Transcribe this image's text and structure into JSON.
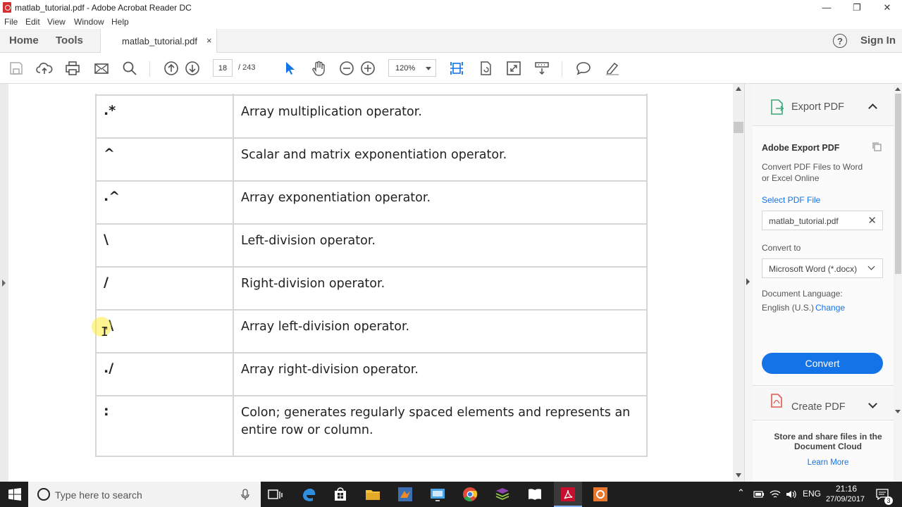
{
  "window": {
    "title": "matlab_tutorial.pdf - Adobe Acrobat Reader DC",
    "minimize": "—",
    "maximize": "❐",
    "close": "✕"
  },
  "menu": [
    "File",
    "Edit",
    "View",
    "Window",
    "Help"
  ],
  "tabs": {
    "home": "Home",
    "tools": "Tools",
    "document": "matlab_tutorial.pdf",
    "close": "×"
  },
  "header": {
    "help": "?",
    "signin": "Sign In"
  },
  "toolbar": {
    "page_current": "18",
    "page_total": "/ 243",
    "zoom": "120%"
  },
  "operators": [
    {
      "op": ".*",
      "desc": "Array multiplication operator."
    },
    {
      "op": "^",
      "desc": "Scalar and matrix exponentiation operator."
    },
    {
      "op": ".^",
      "desc": "Array exponentiation operator."
    },
    {
      "op": "\\",
      "desc": "Left-division operator."
    },
    {
      "op": "/",
      "desc": "Right-division operator."
    },
    {
      "op": ".\\",
      "desc": "Array left-division operator."
    },
    {
      "op": "./",
      "desc": "Array right-division operator."
    },
    {
      "op": ":",
      "desc": "Colon; generates regularly spaced elements and represents an entire row or column."
    }
  ],
  "panel": {
    "export_title": "Export PDF",
    "service_title": "Adobe Export PDF",
    "service_desc": "Convert PDF Files to Word or Excel Online",
    "select_label": "Select PDF File",
    "selected_file": "matlab_tutorial.pdf",
    "convert_to_label": "Convert to",
    "convert_to_value": "Microsoft Word (*.docx)",
    "language_label": "Document Language:",
    "language_value": "English (U.S.)",
    "change_link": "Change",
    "convert_button": "Convert",
    "create_title": "Create PDF",
    "cloud_text": "Store and share files in the Document Cloud",
    "learn_more": "Learn More"
  },
  "taskbar": {
    "search_placeholder": "Type here to search",
    "language": "ENG",
    "time": "21:16",
    "date": "27/09/2017",
    "notification_count": "3"
  },
  "colors": {
    "accent": "#1473e6",
    "pdf_red": "#d32f2f",
    "link": "#1473e6"
  }
}
